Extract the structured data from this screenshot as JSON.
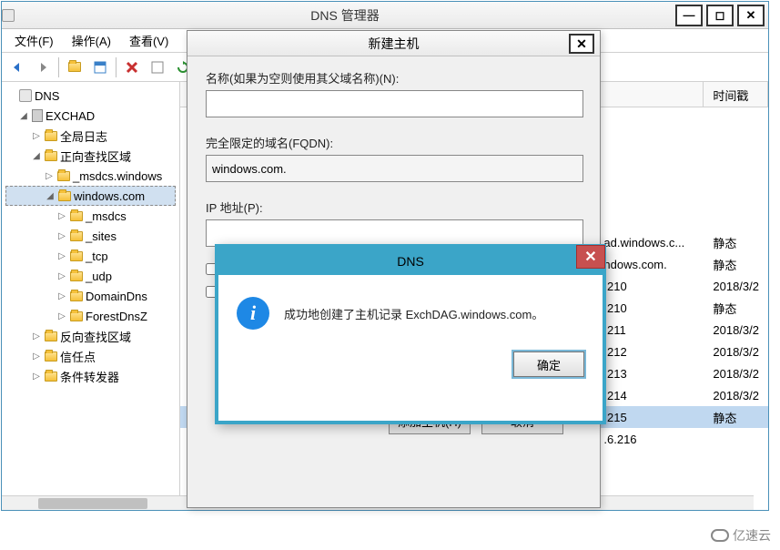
{
  "window": {
    "title": "DNS 管理器"
  },
  "menus": [
    "文件(F)",
    "操作(A)",
    "查看(V)"
  ],
  "tree": {
    "root": "DNS",
    "server": "EXCHAD",
    "global_log": "全局日志",
    "fwd_zone": "正向查找区域",
    "msdcs_win": "_msdcs.windows",
    "windows_com": "windows.com",
    "children": [
      "_msdcs",
      "_sites",
      "_tcp",
      "_udp",
      "DomainDns",
      "ForestDnsZ"
    ],
    "rev_zone": "反向查找区域",
    "trust": "信任点",
    "cond_fwd": "条件转发器"
  },
  "list": {
    "header_time": "时间戳",
    "rows": [
      {
        "host": "ad.windows.c...",
        "ts": "静态"
      },
      {
        "host": "ndows.com.",
        "ts": "静态"
      },
      {
        "host": ".210",
        "ts": "2018/3/2"
      },
      {
        "host": ".210",
        "ts": "静态"
      },
      {
        "host": ".211",
        "ts": "2018/3/2"
      },
      {
        "host": ".212",
        "ts": "2018/3/2"
      },
      {
        "host": ".213",
        "ts": "2018/3/2"
      },
      {
        "host": ".214",
        "ts": "2018/3/2"
      },
      {
        "host": ".215",
        "ts": "静态"
      },
      {
        "host": ".6.216",
        "ts": ""
      }
    ]
  },
  "newhost": {
    "title": "新建主机",
    "name_label": "名称(如果为空则使用其父域名称)(N):",
    "fqdn_label": "完全限定的域名(FQDN):",
    "fqdn_value": "windows.com.",
    "ip_label": "IP 地址(P):",
    "add_btn": "添加主机(H)",
    "cancel_btn": "取消"
  },
  "msgbox": {
    "title": "DNS",
    "message": "成功地创建了主机记录 ExchDAG.windows.com。",
    "ok": "确定"
  },
  "watermark": "亿速云"
}
